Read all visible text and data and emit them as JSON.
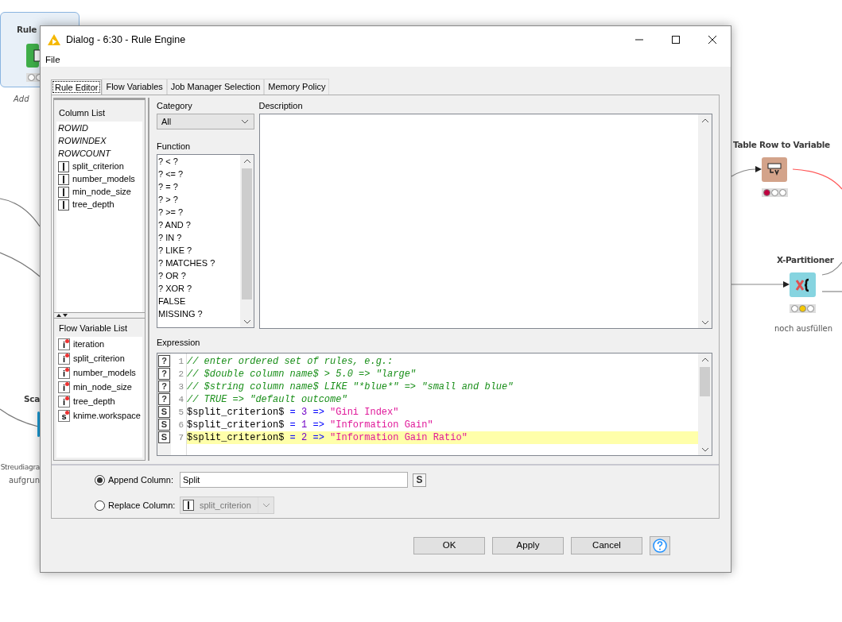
{
  "canvas": {
    "nodes": [
      {
        "kind": "rule_engine",
        "label": "Rule",
        "note": "Add",
        "lights": [
          {
            "lit": false
          },
          {
            "lit": false
          }
        ],
        "selected": true
      },
      {
        "kind": "scatter",
        "label": "Sca",
        "note": "Streudiagra",
        "note2": "aufgrun",
        "selected": false
      },
      {
        "kind": "table_row",
        "label": "Table Row to Variable",
        "lights": [
          {
            "lit": true
          },
          {
            "lit": false
          },
          {
            "lit": false
          }
        ],
        "selected": false
      },
      {
        "kind": "partitioner",
        "label": "X-Partitioner",
        "note": "noch ausfüllen",
        "lights": [
          {
            "lit": false
          },
          {
            "lit": true
          },
          {
            "lit": false
          }
        ],
        "selected": false
      }
    ]
  },
  "window": {
    "title": "Dialog - 6:30 - Rule Engine"
  },
  "menu": [
    "File"
  ],
  "tabs": [
    {
      "label": "Rule Editor",
      "selected": true
    },
    {
      "label": "Flow Variables",
      "selected": false
    },
    {
      "label": "Job Manager Selection",
      "selected": false
    },
    {
      "label": "Memory Policy",
      "selected": false
    }
  ],
  "column_list": {
    "title": "Column List",
    "items": [
      {
        "name": "ROWID",
        "kind": "special"
      },
      {
        "name": "ROWINDEX",
        "kind": "special"
      },
      {
        "name": "ROWCOUNT",
        "kind": "special"
      },
      {
        "name": "split_criterion",
        "kind": "integer"
      },
      {
        "name": "number_models",
        "kind": "integer"
      },
      {
        "name": "min_node_size",
        "kind": "integer"
      },
      {
        "name": "tree_depth",
        "kind": "integer"
      }
    ]
  },
  "flow_variable_list": {
    "title": "Flow Variable List",
    "items": [
      {
        "type": "i",
        "name": "iteration"
      },
      {
        "type": "i",
        "name": "split_criterion"
      },
      {
        "type": "i",
        "name": "number_models"
      },
      {
        "type": "i",
        "name": "min_node_size"
      },
      {
        "type": "i",
        "name": "tree_depth"
      },
      {
        "type": "s",
        "name": "knime.workspace"
      }
    ]
  },
  "category": {
    "label": "Category",
    "value": "All"
  },
  "function": {
    "label": "Function",
    "items": [
      "? < ?",
      "? <= ?",
      "? = ?",
      "? > ?",
      "? >= ?",
      "? AND ?",
      "? IN ?",
      "? LIKE ?",
      "? MATCHES ?",
      "? OR ?",
      "? XOR ?",
      "FALSE",
      "MISSING ?"
    ]
  },
  "description": {
    "label": "Description"
  },
  "expression": {
    "label": "Expression",
    "lines": [
      {
        "number": "1",
        "marker": "?",
        "highlighted": false,
        "tokens": [
          {
            "kind": "comment",
            "text": "// enter ordered set of rules, e.g.:"
          }
        ]
      },
      {
        "number": "2",
        "marker": "?",
        "highlighted": false,
        "tokens": [
          {
            "kind": "comment",
            "text": "// $double column name$ > 5.0 => \"large\""
          }
        ]
      },
      {
        "number": "3",
        "marker": "?",
        "highlighted": false,
        "tokens": [
          {
            "kind": "comment",
            "text": "// $string column name$ LIKE \"*blue*\" => \"small and blue\""
          }
        ]
      },
      {
        "number": "4",
        "marker": "?",
        "highlighted": false,
        "tokens": [
          {
            "kind": "comment",
            "text": "// TRUE => \"default outcome\""
          }
        ]
      },
      {
        "number": "5",
        "marker": "S",
        "highlighted": false,
        "tokens": [
          {
            "kind": "variable",
            "text": "$split_criterion$"
          },
          {
            "kind": "operator",
            "text": " = "
          },
          {
            "kind": "number",
            "text": "3"
          },
          {
            "kind": "operator",
            "text": " => "
          },
          {
            "kind": "string",
            "text": "\"Gini Index\""
          }
        ]
      },
      {
        "number": "6",
        "marker": "S",
        "highlighted": false,
        "tokens": [
          {
            "kind": "variable",
            "text": "$split_criterion$"
          },
          {
            "kind": "operator",
            "text": " = "
          },
          {
            "kind": "number",
            "text": "1"
          },
          {
            "kind": "operator",
            "text": " => "
          },
          {
            "kind": "string",
            "text": "\"Information Gain\""
          }
        ]
      },
      {
        "number": "7",
        "marker": "S",
        "highlighted": true,
        "tokens": [
          {
            "kind": "variable",
            "text": "$split_criterion$"
          },
          {
            "kind": "operator",
            "text": " = "
          },
          {
            "kind": "number",
            "text": "2"
          },
          {
            "kind": "operator",
            "text": " => "
          },
          {
            "kind": "string",
            "text": "\"Information Gain Ratio\""
          }
        ]
      }
    ]
  },
  "output": [
    {
      "kind": "text",
      "label": "Append Column:",
      "selected": true,
      "value": "Split",
      "type_button": "S"
    },
    {
      "kind": "select",
      "label": "Replace Column:",
      "selected": false,
      "value": "split_criterion"
    }
  ],
  "buttons": [
    "OK",
    "Apply",
    "Cancel"
  ]
}
